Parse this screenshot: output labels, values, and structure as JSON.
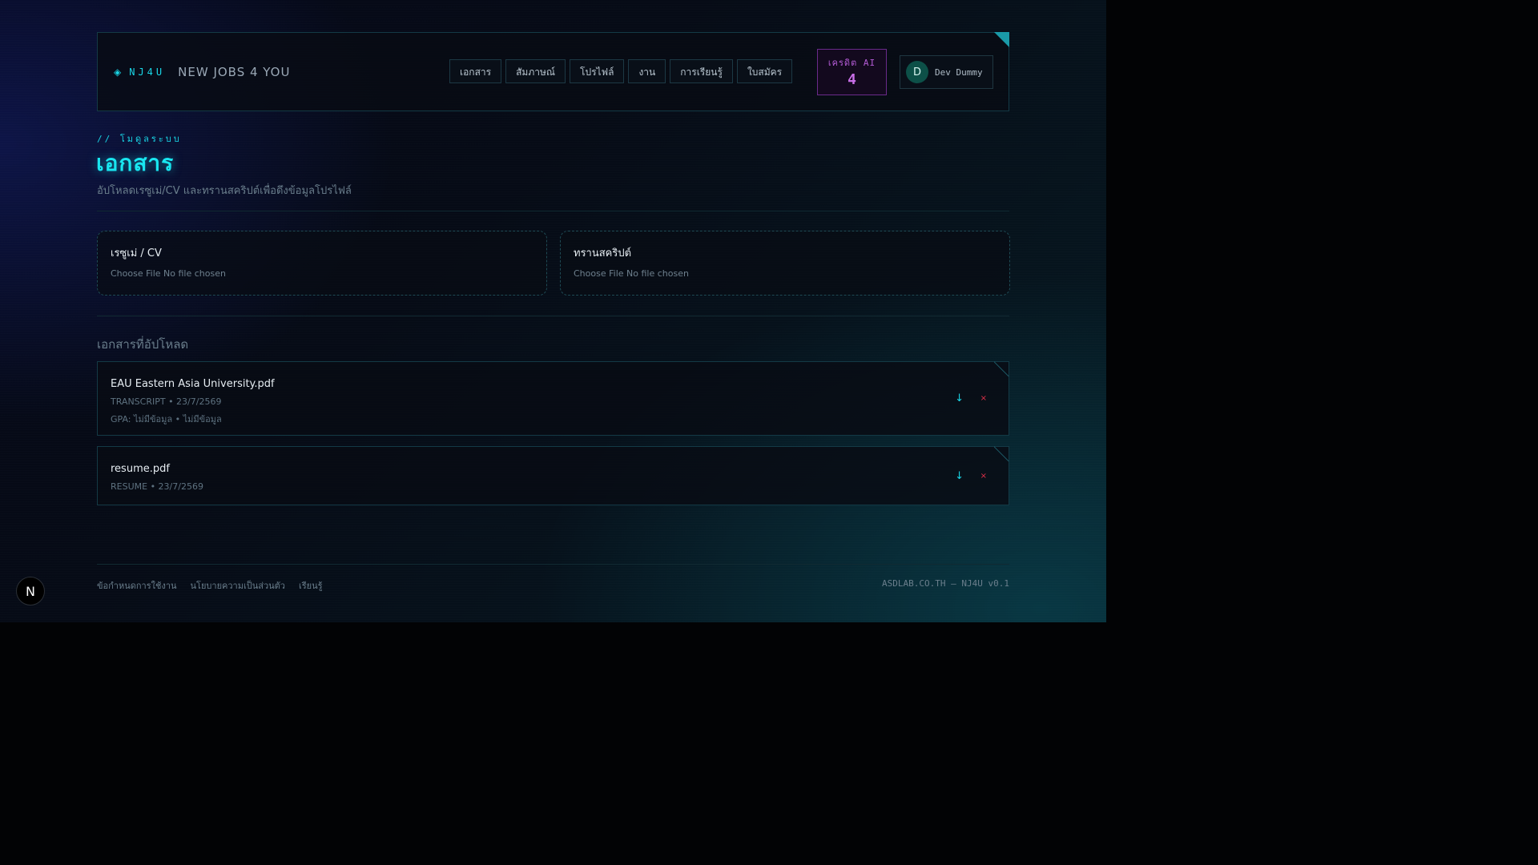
{
  "header": {
    "brand_code": "NJ4U",
    "brand_name": "NEW JOBS 4 YOU",
    "nav": [
      {
        "label": "เอกสาร"
      },
      {
        "label": "สัมภาษณ์"
      },
      {
        "label": "โปรไฟล์"
      },
      {
        "label": "งาน"
      },
      {
        "label": "การเรียนรู้"
      },
      {
        "label": "ใบสมัคร"
      }
    ],
    "credits_label": "เครดิต AI",
    "credits_value": "4",
    "user_initial": "D",
    "user_name": "Dev Dummy"
  },
  "page": {
    "kicker": "// โมดูลระบบ",
    "title": "เอกสาร",
    "subtitle": "อัปโหลดเรซูเม่/CV และทรานสคริปต์เพื่อดึงข้อมูลโปรไฟล์"
  },
  "uploads": [
    {
      "label": "เรซูเม่ / CV",
      "file_text": "Choose File No file chosen"
    },
    {
      "label": "ทรานสคริปต์",
      "file_text": "Choose File No file chosen"
    }
  ],
  "uploaded_heading": "เอกสารที่อัปโหลด",
  "documents": [
    {
      "name": "EAU Eastern Asia University.pdf",
      "meta": "TRANSCRIPT • 23/7/2569",
      "gpa": "GPA: ไม่มีข้อมูล • ไม่มีข้อมูล",
      "download_icon": "↓",
      "remove_icon": "×"
    },
    {
      "name": "resume.pdf",
      "meta": "RESUME • 23/7/2569",
      "download_icon": "↓",
      "remove_icon": "×"
    }
  ],
  "footer": {
    "links": [
      {
        "label": "ข้อกำหนดการใช้งาน"
      },
      {
        "label": "นโยบายความเป็นส่วนตัว"
      },
      {
        "label": "เรียนรู้"
      }
    ],
    "right": "ASDLAB.CO.TH — NJ4U v0.1"
  },
  "next_badge": "N",
  "colors": {
    "accent": "#19d6e6",
    "credits": "#c86ee6",
    "danger": "#e0304a"
  }
}
